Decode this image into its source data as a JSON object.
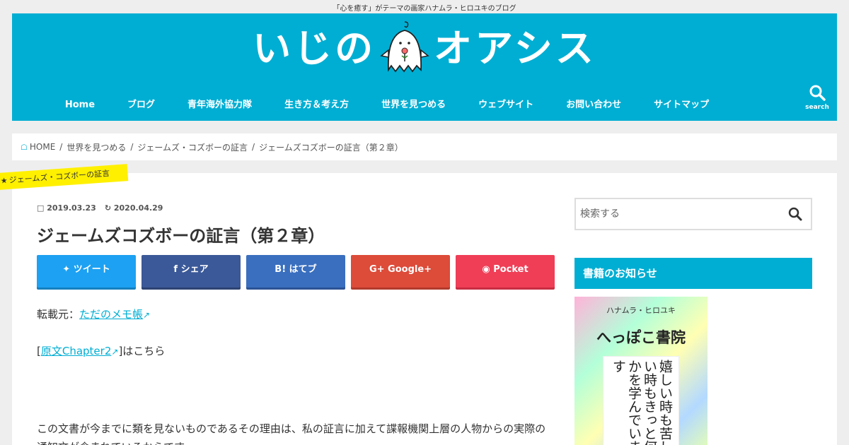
{
  "site": {
    "tagline": "「心を癒す」がテーマの画家ハナムラ・ヒロユキのブログ",
    "logo_text_left": "いじの",
    "logo_text_right": "オアシス",
    "colors": {
      "brand": "#00aed3",
      "ribbon": "#fff000"
    }
  },
  "nav": {
    "items": [
      "Home",
      "ブログ",
      "青年海外協力隊",
      "生き方＆考え方",
      "世界を見つめる",
      "ウェブサイト",
      "お問い合わせ",
      "サイトマップ"
    ],
    "search_label": "search"
  },
  "breadcrumb": {
    "home": "HOME",
    "items": [
      "世界を見つめる",
      "ジェームズ・コズボーの証言",
      "ジェームズコズボーの証言（第２章）"
    ]
  },
  "article": {
    "category": "ジェームズ・コズボーの証言",
    "published": "2019.03.23",
    "updated": "2020.04.29",
    "title": "ジェームズコズボーの証言（第２章）",
    "share": {
      "twitter": "ツイート",
      "facebook": "シェア",
      "hatena": "はてブ",
      "google": "Google+",
      "pocket": "Pocket"
    },
    "source_label": "転載元：",
    "source_link": "ただのメモ帳",
    "original_prefix": "[",
    "original_link": "原文Chapter2",
    "original_suffix": "]はこちら",
    "body": "この文書が今までに類を見ないものであるその理由は、私の証言に加えて諜報機関上層の人物からの実際の通知文が含まれているからです。"
  },
  "sidebar": {
    "search_placeholder": "検索する",
    "widget_title": "書籍のお知らせ",
    "book": {
      "author": "ハナムラ・ヒロユキ",
      "title": "へっぽこ書院",
      "calligraphy": "嬉しい時も苦しい時もきっと何かを学んでいます"
    }
  }
}
